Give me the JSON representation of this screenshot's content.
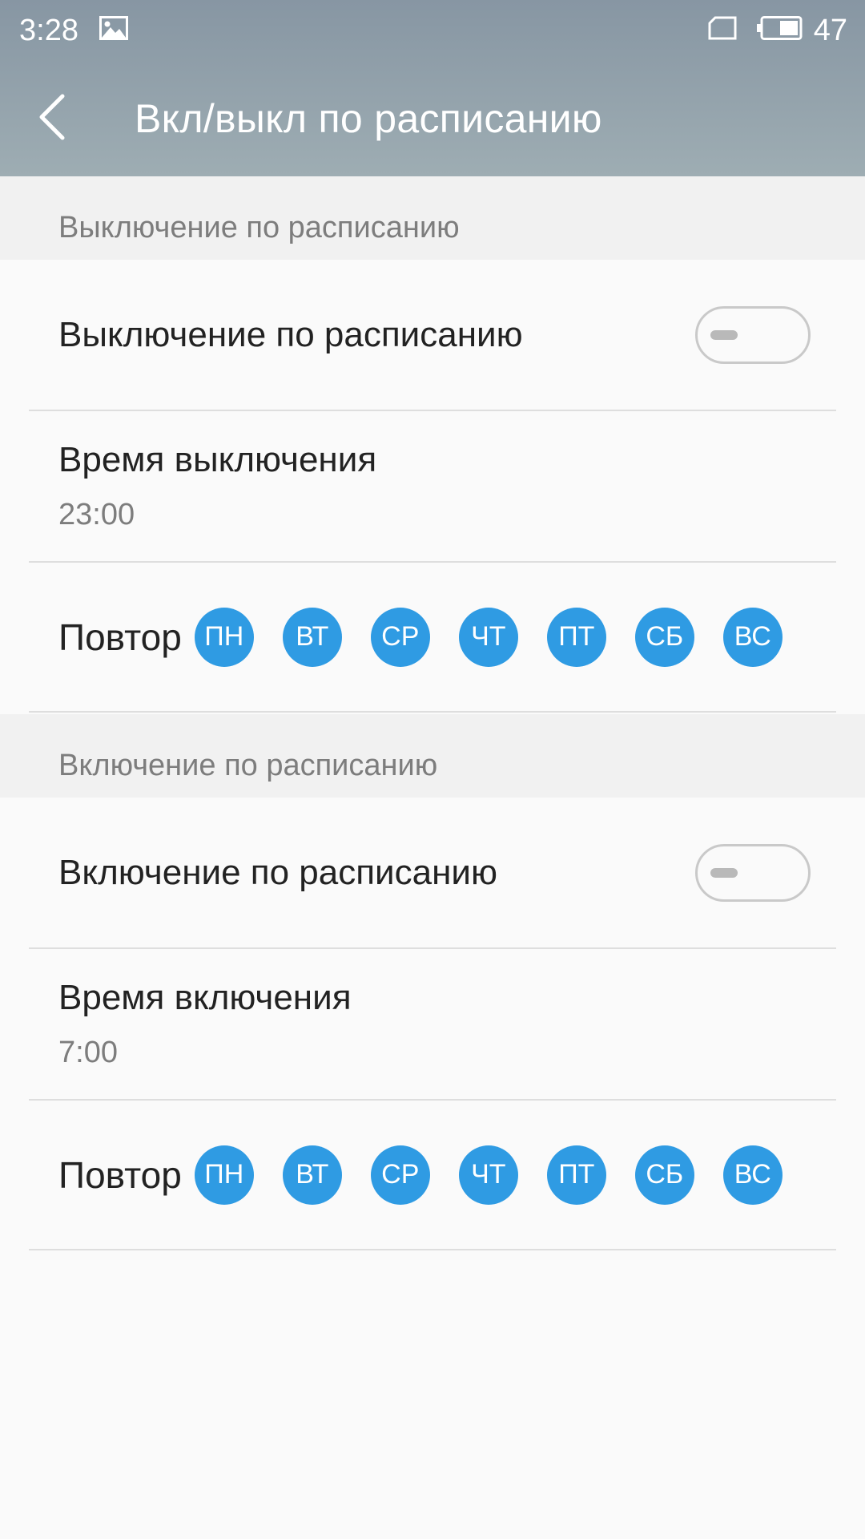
{
  "status_bar": {
    "time": "3:28",
    "battery": "47",
    "icons": [
      "image-icon",
      "sim-icon",
      "battery-icon"
    ]
  },
  "header": {
    "title": "Вкл/выкл по расписанию",
    "back_icon": "chevron-left-icon"
  },
  "shutdown": {
    "section_title": "Выключение по расписанию",
    "toggle_label": "Выключение по расписанию",
    "toggle_on": false,
    "time_label": "Время выключения",
    "time_value": "23:00",
    "repeat_label": "Повтор",
    "days": [
      "ПН",
      "ВТ",
      "СР",
      "ЧТ",
      "ПТ",
      "СБ",
      "ВС"
    ]
  },
  "startup": {
    "section_title": "Включение по расписанию",
    "toggle_label": "Включение по расписанию",
    "toggle_on": false,
    "time_label": "Время включения",
    "time_value": "7:00",
    "repeat_label": "Повтор",
    "days": [
      "ПН",
      "ВТ",
      "СР",
      "ЧТ",
      "ПТ",
      "СБ",
      "ВС"
    ]
  },
  "colors": {
    "accent": "#2f9be3",
    "appbar_top": "#8796a3",
    "appbar_bottom": "#9eadb3",
    "background": "#fafafa",
    "section_bg": "#f1f1f1"
  }
}
